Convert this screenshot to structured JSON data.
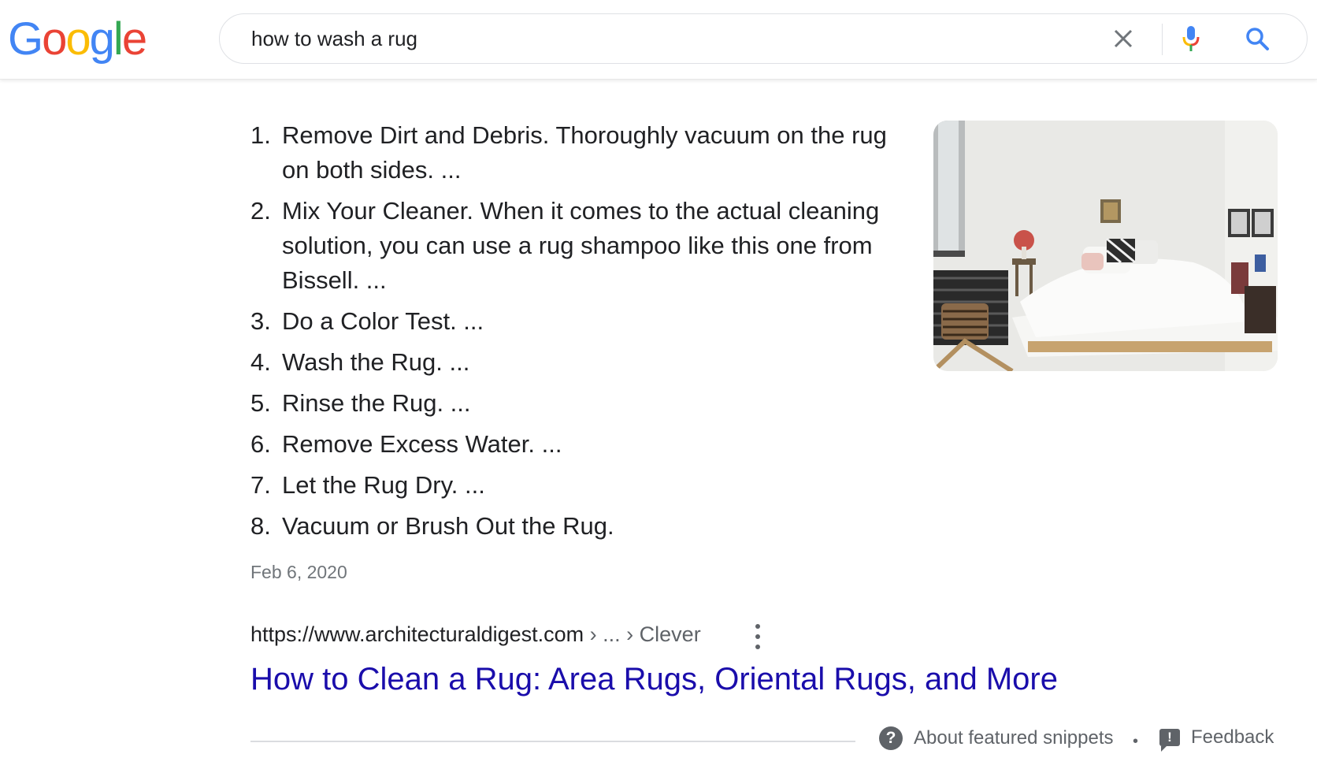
{
  "logo": {
    "letters": [
      "G",
      "o",
      "o",
      "g",
      "l",
      "e"
    ],
    "colors": [
      "#4285F4",
      "#EA4335",
      "#FBBC05",
      "#4285F4",
      "#34A853",
      "#EA4335"
    ]
  },
  "search": {
    "query": "how to wash a rug"
  },
  "snippet": {
    "steps": [
      {
        "num": "1.",
        "text": "Remove Dirt and Debris. Thoroughly vacuum on the rug on both sides. ..."
      },
      {
        "num": "2.",
        "text": "Mix Your Cleaner. When it comes to the actual cleaning solution, you can use a rug shampoo like this one from Bissell. ..."
      },
      {
        "num": "3.",
        "text": "Do a Color Test. ..."
      },
      {
        "num": "4.",
        "text": "Wash the Rug. ..."
      },
      {
        "num": "5.",
        "text": "Rinse the Rug. ..."
      },
      {
        "num": "6.",
        "text": "Remove Excess Water. ..."
      },
      {
        "num": "7.",
        "text": "Let the Rug Dry. ..."
      },
      {
        "num": "8.",
        "text": "Vacuum or Brush Out the Rug."
      }
    ],
    "date": "Feb 6, 2020",
    "image_alt": "bedroom with rug"
  },
  "result": {
    "url": "https://www.architecturaldigest.com",
    "breadcrumb": " › ... › Clever",
    "title": "How to Clean a Rug: Area Rugs, Oriental Rugs, and More"
  },
  "footer": {
    "about_label": "About featured snippets",
    "separator": "•",
    "feedback_label": "Feedback"
  },
  "colors": {
    "link": "#1a0dab",
    "muted": "#70757a",
    "icon": "#5f6368"
  }
}
